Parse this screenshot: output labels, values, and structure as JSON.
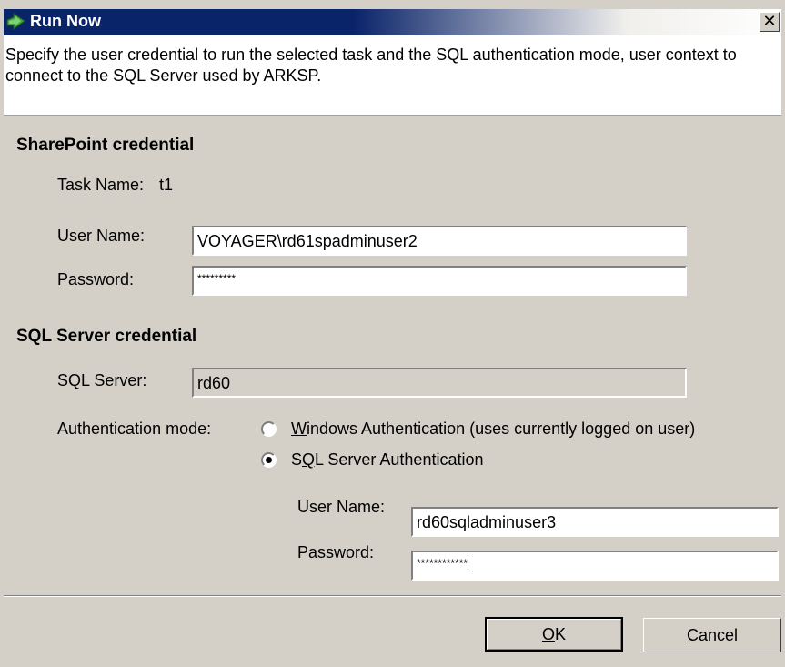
{
  "window": {
    "title": "Run Now",
    "close_glyph": "✕",
    "description": "Specify the user credential to run the selected task and the SQL authentication mode, user context to connect to the SQL Server used by ARKSP."
  },
  "sharepoint": {
    "section_title": "SharePoint credential",
    "task_name_label": "Task Name:",
    "task_name_value": "t1",
    "username_label": "User Name:",
    "username_value": "VOYAGER\\rd61spadminuser2",
    "password_label": "Password:",
    "password_value": "*********"
  },
  "sql": {
    "section_title": "SQL Server credential",
    "server_label": "SQL Server:",
    "server_value": "rd60",
    "auth_label": "Authentication mode:",
    "auth_options": [
      {
        "prefix": "",
        "mnemonic": "W",
        "rest": "indows Authentication (uses currently logged on user)",
        "selected": false
      },
      {
        "prefix": "S",
        "mnemonic": "Q",
        "rest": "L Server Authentication",
        "selected": true
      }
    ],
    "username_label": "User Name:",
    "username_value": "rd60sqladminuser3",
    "password_label": "Password:",
    "password_value": "************"
  },
  "buttons": {
    "ok": {
      "mnemonic": "O",
      "rest": "K"
    },
    "cancel": {
      "mnemonic": "C",
      "rest": "ancel"
    }
  },
  "colors": {
    "titlebar": "#0a246a",
    "dialog_bg": "#d4d0c8",
    "icon": "arrow-run-icon"
  }
}
